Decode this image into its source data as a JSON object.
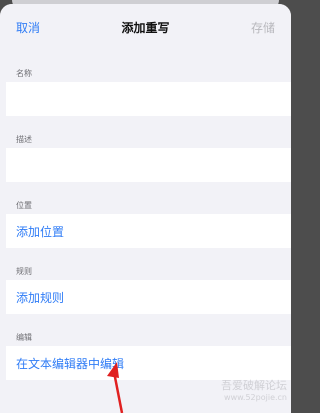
{
  "navbar": {
    "cancel_label": "取消",
    "title": "添加重写",
    "save_label": "存储"
  },
  "sections": {
    "name": {
      "label": "名称"
    },
    "description": {
      "label": "描述"
    },
    "location": {
      "label": "位置",
      "action": "添加位置"
    },
    "rules": {
      "label": "规则",
      "action": "添加规则"
    },
    "edit": {
      "label": "编辑",
      "action": "在文本编辑器中编辑"
    }
  },
  "watermark": {
    "line1": "吾爱破解论坛",
    "line2": "www.52pojie.cn"
  },
  "colors": {
    "accent": "#2f7cf6",
    "annotation_arrow": "#e02020"
  }
}
